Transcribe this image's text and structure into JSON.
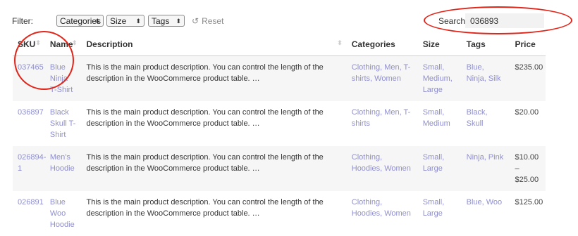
{
  "filter": {
    "label": "Filter:",
    "categories": "Categories",
    "size": "Size",
    "tags": "Tags",
    "reset": "Reset",
    "arrow_glyph": "⬍"
  },
  "search": {
    "label": "Search:",
    "value": "036893"
  },
  "table": {
    "headers": [
      "SKU",
      "Name",
      "Description",
      "Categories",
      "Size",
      "Tags",
      "Price"
    ],
    "rows": [
      {
        "sku": "037465",
        "name": "Blue Ninja T-Shirt",
        "description": "This is the main product description. You can control the length of the description in the WooCommerce product table. …",
        "categories": "Clothing, Men, T-shirts, Women",
        "size": "Small, Medium, Large",
        "tags": "Blue, Ninja, Silk",
        "price": "$235.00"
      },
      {
        "sku": "036897",
        "name": "Black Skull T-Shirt",
        "description": "This is the main product description. You can control the length of the description in the WooCommerce product table. …",
        "categories": "Clothing, Men, T-shirts",
        "size": "Small, Medium",
        "tags": "Black, Skull",
        "price": "$20.00"
      },
      {
        "sku": "026894-1",
        "name": "Men's Hoodie",
        "description": "This is the main product description. You can control the length of the description in the WooCommerce product table. …",
        "categories": "Clothing, Hoodies, Women",
        "size": "Small, Large",
        "tags": "Ninja, Pink",
        "price": "$10.00 – $25.00"
      },
      {
        "sku": "026891",
        "name": "Blue Woo Hoodie",
        "description": "This is the main product description. You can control the length of the description in the WooCommerce product table. …",
        "categories": "Clothing, Hoodies, Women",
        "size": "Small, Large",
        "tags": "Blue, Woo",
        "price": "$125.00"
      }
    ]
  },
  "colors": {
    "link": "#8f8fcf",
    "annotation": "#e0261b",
    "stripe": "#f6f6f6"
  }
}
